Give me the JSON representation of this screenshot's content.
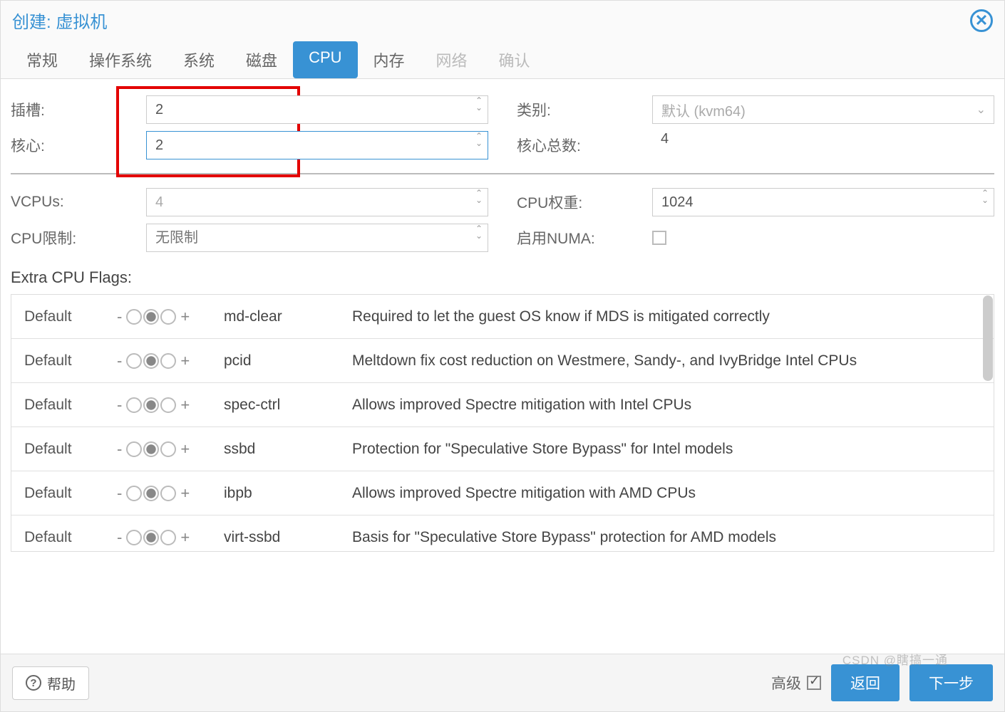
{
  "dialog": {
    "title": "创建: 虚拟机"
  },
  "tabs": [
    {
      "label": "常规",
      "state": "normal"
    },
    {
      "label": "操作系统",
      "state": "normal"
    },
    {
      "label": "系统",
      "state": "normal"
    },
    {
      "label": "磁盘",
      "state": "normal"
    },
    {
      "label": "CPU",
      "state": "active"
    },
    {
      "label": "内存",
      "state": "normal"
    },
    {
      "label": "网络",
      "state": "disabled"
    },
    {
      "label": "确认",
      "state": "disabled"
    }
  ],
  "form": {
    "sockets": {
      "label": "插槽:",
      "value": "2"
    },
    "cores": {
      "label": "核心:",
      "value": "2"
    },
    "type": {
      "label": "类别:",
      "value": "默认 (kvm64)"
    },
    "total_cores": {
      "label": "核心总数:",
      "value": "4"
    },
    "vcpus": {
      "label": "VCPUs:",
      "value": "4"
    },
    "cpu_weight": {
      "label": "CPU权重:",
      "value": "1024"
    },
    "cpu_limit": {
      "label": "CPU限制:",
      "placeholder": "无限制"
    },
    "numa": {
      "label": "启用NUMA:",
      "checked": false
    }
  },
  "flags_title": "Extra CPU Flags:",
  "flag_default_label": "Default",
  "flags": [
    {
      "name": "md-clear",
      "desc": "Required to let the guest OS know if MDS is mitigated correctly"
    },
    {
      "name": "pcid",
      "desc": "Meltdown fix cost reduction on Westmere, Sandy-, and IvyBridge Intel CPUs"
    },
    {
      "name": "spec-ctrl",
      "desc": "Allows improved Spectre mitigation with Intel CPUs"
    },
    {
      "name": "ssbd",
      "desc": "Protection for \"Speculative Store Bypass\" for Intel models"
    },
    {
      "name": "ibpb",
      "desc": "Allows improved Spectre mitigation with AMD CPUs"
    },
    {
      "name": "virt-ssbd",
      "desc": "Basis for \"Speculative Store Bypass\" protection for AMD models"
    }
  ],
  "footer": {
    "help": "帮助",
    "advanced": "高级",
    "back": "返回",
    "next": "下一步"
  },
  "watermark": "CSDN @瞎搞一通"
}
